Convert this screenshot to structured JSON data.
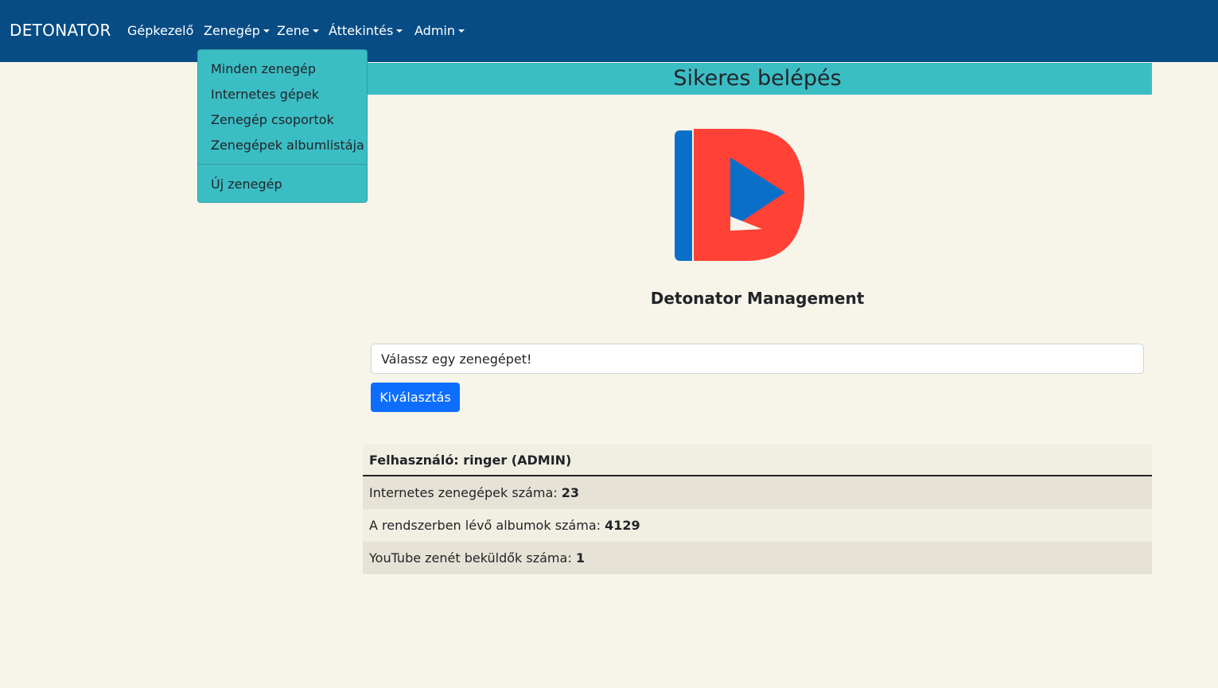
{
  "brand": "DETONATOR",
  "nav": {
    "items": [
      {
        "label": "Gépkezelő",
        "dropdown": false
      },
      {
        "label": "Zenegép",
        "dropdown": true
      },
      {
        "label": "Zene",
        "dropdown": true
      },
      {
        "label": "Áttekintés",
        "dropdown": true
      },
      {
        "label": "Admin",
        "dropdown": true
      }
    ]
  },
  "dropdown": {
    "items": [
      "Minden zenegép",
      "Internetes gépek",
      "Zenegép csoportok",
      "Zenegépek albumlistája"
    ],
    "extra_item": "Új zenegép"
  },
  "header": {
    "title": "Sikeres belépés"
  },
  "logo": {
    "icon": "detonator-logo-icon",
    "colors": {
      "red": "#ff4136",
      "blue": "#0a6fc9"
    }
  },
  "subtitle": "Detonator Management",
  "form": {
    "select_value": "Válassz egy zenegépet!",
    "button_label": "Kiválasztás"
  },
  "stats": {
    "user_label": "Felhasználó: ringer (ADMIN)",
    "rows": [
      {
        "label": "Internetes zenegépek száma:",
        "value": "23"
      },
      {
        "label": "A rendszerben lévő albumok száma:",
        "value": "4129"
      },
      {
        "label": "YouTube zenét beküldők száma:",
        "value": "1"
      }
    ]
  },
  "colors": {
    "navbar": "#084c85",
    "accent": "#3bbdc4",
    "button": "#0d6efd",
    "background": "#f7f4ea"
  }
}
